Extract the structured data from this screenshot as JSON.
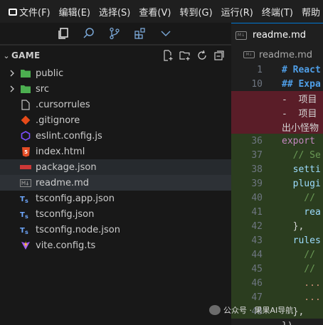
{
  "menu": [
    "文件(F)",
    "编辑(E)",
    "选择(S)",
    "查看(V)",
    "转到(G)",
    "运行(R)",
    "终端(T)",
    "帮助"
  ],
  "activity_icons": [
    "files-icon",
    "search-icon",
    "source-control-icon",
    "extensions-icon",
    "chevron-down-icon"
  ],
  "explorer": {
    "section_title": "GAME",
    "actions": [
      "new-file-icon",
      "new-folder-icon",
      "refresh-icon",
      "collapse-all-icon"
    ],
    "items": [
      {
        "name": "public",
        "type": "folder",
        "icon": "folder-public-icon",
        "color": "#4caf50"
      },
      {
        "name": "src",
        "type": "folder",
        "icon": "folder-src-icon",
        "color": "#4caf50"
      },
      {
        "name": ".cursorrules",
        "type": "file",
        "icon": "file-icon",
        "color": "#c5c5c5"
      },
      {
        "name": ".gitignore",
        "type": "file",
        "icon": "git-icon",
        "color": "#e64a19"
      },
      {
        "name": "eslint.config.js",
        "type": "file",
        "icon": "eslint-icon",
        "color": "#7c4dff"
      },
      {
        "name": "index.html",
        "type": "file",
        "icon": "html-icon",
        "color": "#e44d26"
      },
      {
        "name": "package.json",
        "type": "file",
        "icon": "npm-icon",
        "color": "#cb3837"
      },
      {
        "name": "readme.md",
        "type": "file",
        "icon": "markdown-icon",
        "color": "#8a8a8a"
      },
      {
        "name": "tsconfig.app.json",
        "type": "file",
        "icon": "tsconfig-icon",
        "color": "#3178c6"
      },
      {
        "name": "tsconfig.json",
        "type": "file",
        "icon": "tsconfig-icon",
        "color": "#3178c6"
      },
      {
        "name": "tsconfig.node.json",
        "type": "file",
        "icon": "tsconfig-icon",
        "color": "#3178c6"
      },
      {
        "name": "vite.config.ts",
        "type": "file",
        "icon": "vite-icon",
        "color": "#a259ff"
      }
    ]
  },
  "editor": {
    "tab_label": "readme.md",
    "tab_icon_text": "M↓",
    "breadcrumb": "readme.md",
    "lines": [
      {
        "num": "1",
        "text": "# React",
        "kind": "md"
      },
      {
        "num": "10",
        "text": "## Expa",
        "kind": "md"
      },
      {
        "num": "",
        "text": "-  项目",
        "kind": "removed"
      },
      {
        "num": "",
        "text": "-  项目",
        "kind": "removed"
      },
      {
        "num": "",
        "text": "出小怪物",
        "kind": "wrap"
      },
      {
        "num": "36",
        "text": "export",
        "kind": "kw"
      },
      {
        "num": "37",
        "text": "  // Se",
        "kind": "cmt"
      },
      {
        "num": "38",
        "text": "  setti",
        "kind": "var"
      },
      {
        "num": "39",
        "text": "  plugi",
        "kind": "var"
      },
      {
        "num": "40",
        "text": "    //",
        "kind": "cmt"
      },
      {
        "num": "41",
        "text": "    rea",
        "kind": "var"
      },
      {
        "num": "42",
        "text": "  },",
        "kind": "plain"
      },
      {
        "num": "43",
        "text": "  rules",
        "kind": "var"
      },
      {
        "num": "44",
        "text": "    //",
        "kind": "cmt"
      },
      {
        "num": "45",
        "text": "    //",
        "kind": "cmt"
      },
      {
        "num": "46",
        "text": "    ...",
        "kind": "dot"
      },
      {
        "num": "47",
        "text": "    ...",
        "kind": "dot"
      },
      {
        "num": "48",
        "text": "  },",
        "kind": "plain"
      },
      {
        "num": "",
        "text": "})",
        "kind": "plain"
      }
    ]
  },
  "watermark": "公众号 · 果果AI导航"
}
